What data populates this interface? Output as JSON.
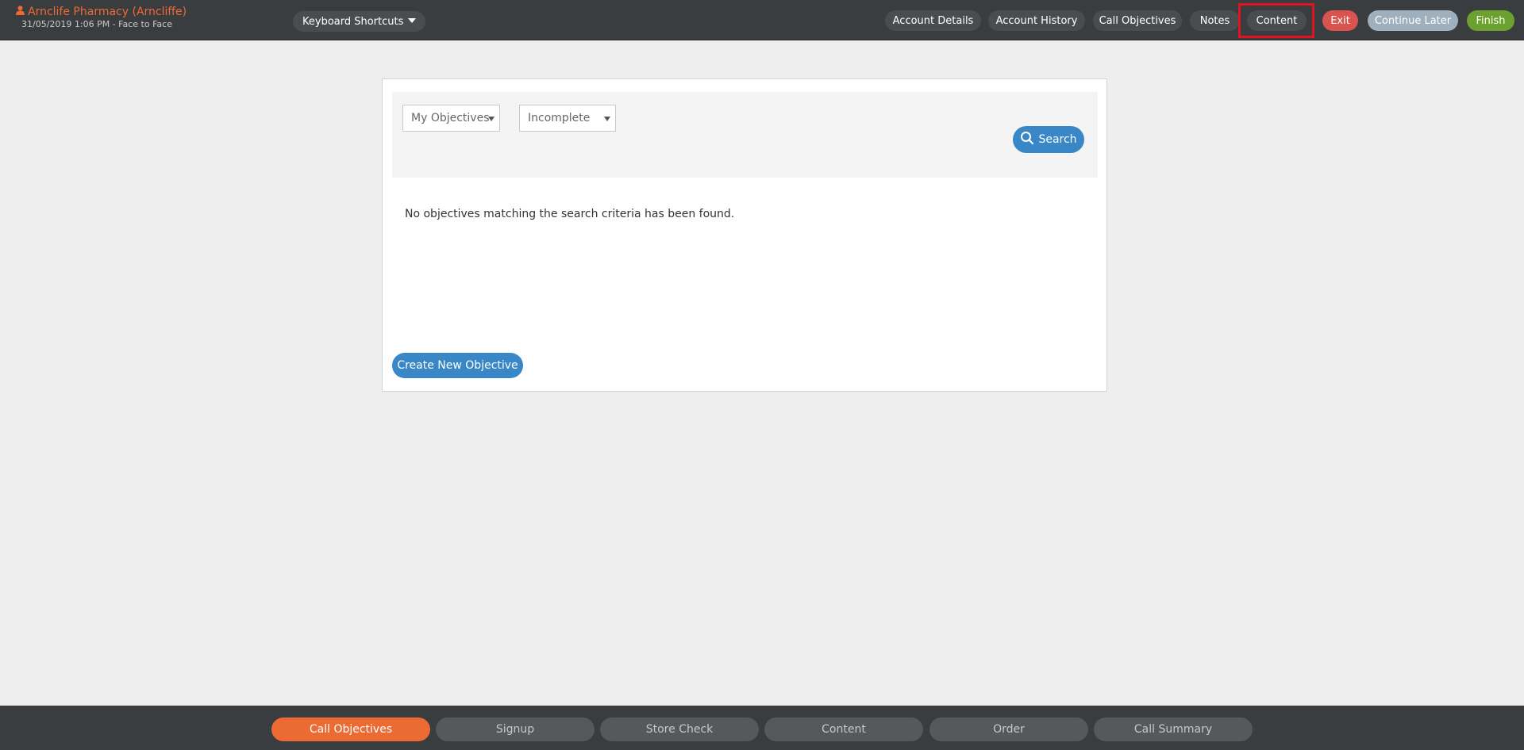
{
  "header": {
    "account_name": "Arnclife Pharmacy (Arncliffe)",
    "account_sub": "31/05/2019 1:06 PM - Face to Face",
    "keyboard_shortcuts": "Keyboard Shortcuts",
    "nav": {
      "account_details": "Account Details",
      "account_history": "Account History",
      "call_objectives": "Call Objectives",
      "notes": "Notes",
      "content": "Content"
    },
    "actions": {
      "exit": "Exit",
      "continue_later": "Continue Later",
      "finish": "Finish"
    }
  },
  "filters": {
    "owner_value": "My Objectives",
    "status_value": "Incomplete",
    "search_label": "Search"
  },
  "results": {
    "empty_message": "No objectives matching the search criteria has been found."
  },
  "create_label": "Create New Objective",
  "steps": [
    {
      "label": "Call Objectives",
      "active": true
    },
    {
      "label": "Signup",
      "active": false
    },
    {
      "label": "Store Check",
      "active": false
    },
    {
      "label": "Content",
      "active": false
    },
    {
      "label": "Order",
      "active": false
    },
    {
      "label": "Call Summary",
      "active": false
    }
  ],
  "colors": {
    "accent_orange": "#ec6a33",
    "primary_blue": "#3a87c8",
    "exit_red": "#d9534f",
    "finish_green": "#6aa12f",
    "highlight_red": "#e0141e"
  }
}
